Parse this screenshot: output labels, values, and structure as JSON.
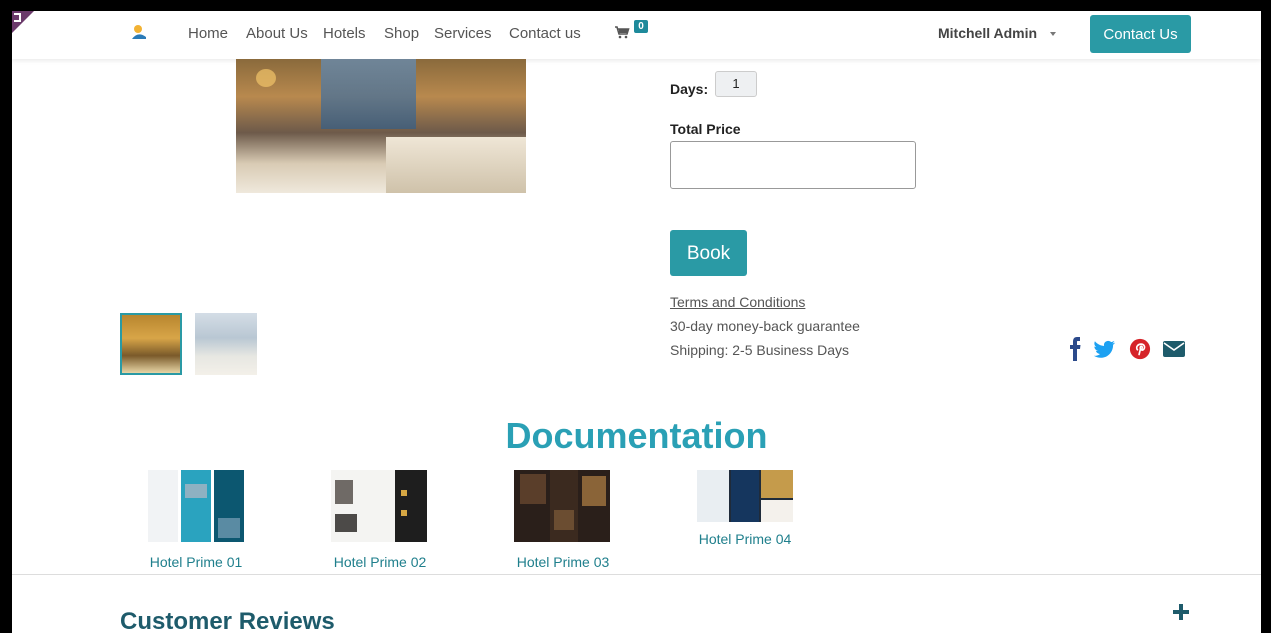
{
  "nav": {
    "links": [
      "Home",
      "About Us",
      "Hotels",
      "Shop",
      "Services",
      "Contact us"
    ],
    "cart_count": "0",
    "user": "Mitchell Admin",
    "contact_button": "Contact Us"
  },
  "booking": {
    "days_label": "Days:",
    "days_value": "1",
    "total_price_label": "Total Price",
    "total_price_value": "",
    "book_button": "Book",
    "terms_link": "Terms and Conditions",
    "guarantee": "30-day money-back guarantee",
    "shipping": "Shipping: 2-5 Business Days"
  },
  "social": [
    "facebook-icon",
    "twitter-icon",
    "pinterest-icon",
    "email-icon"
  ],
  "colors": {
    "accent": "#2a9aa5",
    "heading": "#2aa0b5",
    "link": "#1f7f8c",
    "dark_heading": "#1e5b6b"
  },
  "documentation": {
    "title": "Documentation",
    "items": [
      "Hotel Prime 01",
      "Hotel Prime 02",
      "Hotel Prime 03",
      "Hotel Prime 04"
    ]
  },
  "reviews": {
    "title": "Customer Reviews"
  }
}
